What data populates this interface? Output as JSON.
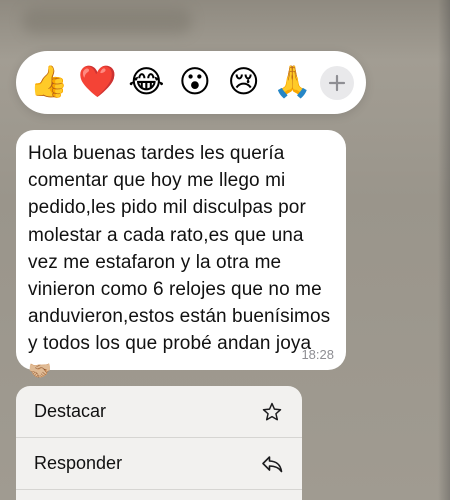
{
  "reactions": {
    "items": [
      {
        "glyph": "👍",
        "name": "thumbs-up"
      },
      {
        "glyph": "❤️",
        "name": "red-heart"
      },
      {
        "glyph": "😂",
        "name": "tears-of-joy"
      },
      {
        "glyph": "😮",
        "name": "surprised-face"
      },
      {
        "glyph": "😢",
        "name": "crying-face"
      },
      {
        "glyph": "🙏",
        "name": "folded-hands"
      }
    ],
    "more_icon": "plus-icon"
  },
  "message": {
    "text": "Hola buenas tardes les quería comentar que hoy me llego mi pedido,les pido mil disculpas por molestar a cada rato,es que una vez me estafaron y la otra me vinieron como 6 relojes que no me anduvieron,estos están buenísimos y todos los que probé andan joya🤝🏼",
    "time": "18:28"
  },
  "menu": {
    "items": [
      {
        "label": "Destacar",
        "icon": "star-outline-icon"
      },
      {
        "label": "Responder",
        "icon": "reply-arrow-icon"
      }
    ]
  },
  "colors": {
    "backdrop": "#9b968c",
    "bubble": "#ffffff",
    "menu": "#f2f1ef",
    "time_text": "#8e8e93"
  }
}
